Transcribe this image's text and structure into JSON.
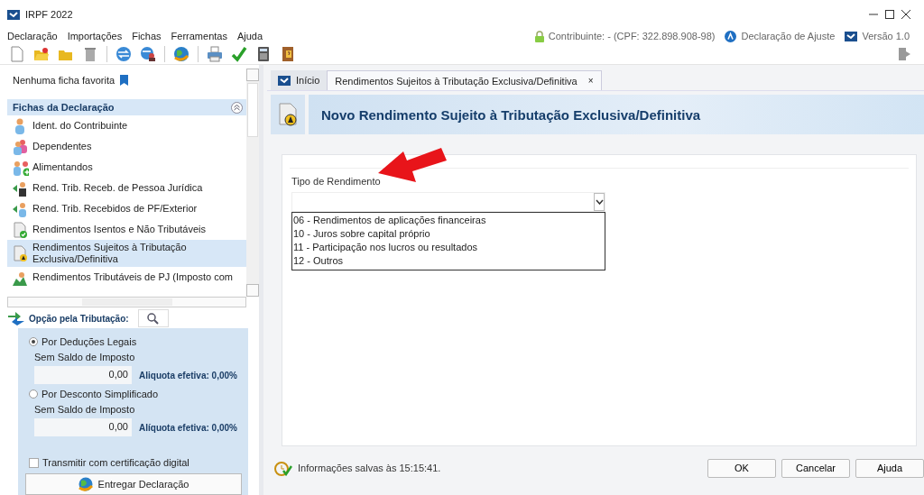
{
  "window": {
    "title": "IRPF 2022"
  },
  "menu": [
    "Declaração",
    "Importações",
    "Fichas",
    "Ferramentas",
    "Ajuda"
  ],
  "status_info": {
    "contribuinte": "Contribuinte:  - (CPF: 322.898.908-98)",
    "declaracao": "Declaração de Ajuste",
    "versao": "Versão 1.0"
  },
  "sidebar": {
    "favorites": "Nenhuma ficha favorita",
    "section": {
      "title": "Fichas da Declaração",
      "expanded": true
    },
    "items": [
      {
        "label": "Ident. do Contribuinte",
        "selected": false
      },
      {
        "label": "Dependentes",
        "selected": false
      },
      {
        "label": "Alimentandos",
        "selected": false
      },
      {
        "label": "Rend. Trib. Receb. de Pessoa Jurídica",
        "selected": false
      },
      {
        "label": "Rend. Trib. Recebidos de PF/Exterior",
        "selected": false
      },
      {
        "label": "Rendimentos Isentos e Não Tributáveis",
        "selected": false
      },
      {
        "label": "Rendimentos Sujeitos à Tributação Exclusiva/Definitiva",
        "selected": true
      },
      {
        "label": "Rendimentos Tributáveis de PJ (Imposto com",
        "selected": false
      }
    ]
  },
  "tributacao": {
    "title": "Opção pela Tributação:",
    "options": [
      {
        "label": "Por Deduções Legais",
        "selected": true,
        "sublabel": "Sem Saldo de Imposto",
        "value": "0,00",
        "aliquota": "Aliquota efetiva: 0,00%"
      },
      {
        "label": "Por Desconto Simplificado",
        "selected": false,
        "sublabel": "Sem Saldo de Imposto",
        "value": "0,00",
        "aliquota": "Alíquota efetiva: 0,00%"
      }
    ],
    "certificado": {
      "label": "Transmitir com certificação digital",
      "checked": false
    },
    "entregar": "Entregar Declaração"
  },
  "tabs": [
    {
      "label": "Início",
      "selected": false
    },
    {
      "label": "Rendimentos Sujeitos à Tributação Exclusiva/Definitiva",
      "selected": true,
      "close": "×"
    }
  ],
  "header": {
    "title": "Novo Rendimento Sujeito à Tributação Exclusiva/Definitiva"
  },
  "form": {
    "label": "Tipo de Rendimento",
    "expanded": true,
    "options": [
      {
        "text": "06 - Rendimentos de aplicações financeiras",
        "selected": false
      },
      {
        "text": "10 - Juros sobre capital próprio",
        "selected": false
      },
      {
        "text": "11 - Participação nos lucros ou resultados",
        "selected": false
      },
      {
        "text": "12 - Outros",
        "selected": false
      }
    ]
  },
  "status_bar": "Informações salvas às 15:15:41.",
  "buttons": [
    "OK",
    "Cancelar",
    "Ajuda"
  ]
}
